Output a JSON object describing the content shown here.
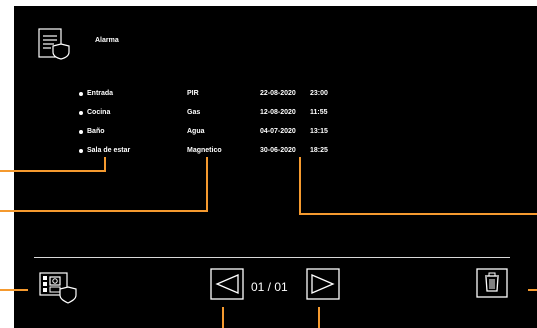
{
  "header": {
    "title": "Alarma",
    "icon": "alarm-shield-icon"
  },
  "alarms": [
    {
      "location": "Entrada",
      "type": "PIR",
      "date": "22-08-2020",
      "time": "23:00"
    },
    {
      "location": "Cocina",
      "type": "Gas",
      "date": "12-08-2020",
      "time": "11:55"
    },
    {
      "location": "Baño",
      "type": "Agua",
      "date": "04-07-2020",
      "time": "13:15"
    },
    {
      "location": "Sala de estar",
      "type": "Magnetico",
      "date": "30-06-2020",
      "time": "18:25"
    }
  ],
  "footer": {
    "pager": "01 / 01",
    "icons": {
      "left": "security-log-icon",
      "prev": "previous-page-icon",
      "next": "next-page-icon",
      "delete": "trash-icon"
    }
  },
  "colors": {
    "screen_bg": "#000000",
    "text": "#ffffff",
    "annotation_lines": "#f59a2f"
  }
}
